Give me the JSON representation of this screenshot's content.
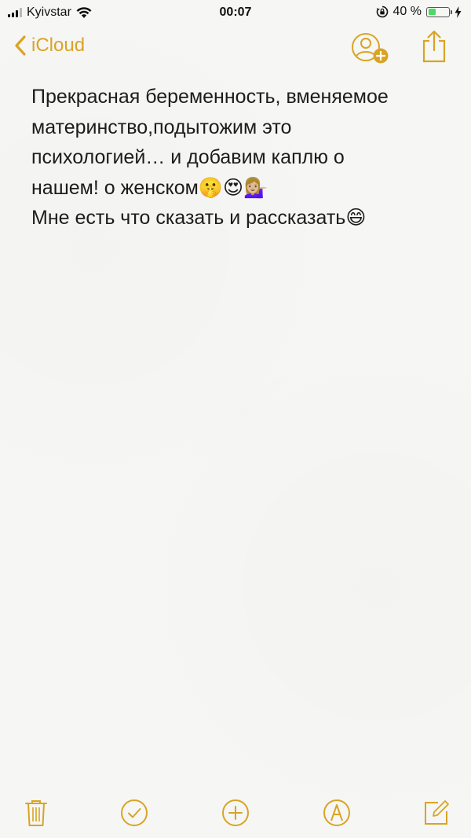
{
  "status_bar": {
    "carrier": "Kyivstar",
    "time": "00:07",
    "battery_percent": "40 %",
    "battery_level": 0.4
  },
  "nav": {
    "back_label": "iCloud",
    "add_person_icon": "add-person-icon",
    "share_icon": "share-icon"
  },
  "note": {
    "lines": [
      "Прекрасная беременность, вменяемое",
      "материнство,подытожим это",
      "психологией… и добавим каплю о",
      "нашем! о женском🤫😍💁🏼‍♀️",
      "Мне есть что сказать и рассказать😄"
    ]
  },
  "toolbar": {
    "items": [
      "trash-icon",
      "checklist-icon",
      "add-icon",
      "markup-icon",
      "compose-icon"
    ]
  },
  "colors": {
    "accent": "#d9a425",
    "background": "#f6f6f4",
    "text": "#1c1c1c",
    "battery": "#4cd964"
  }
}
